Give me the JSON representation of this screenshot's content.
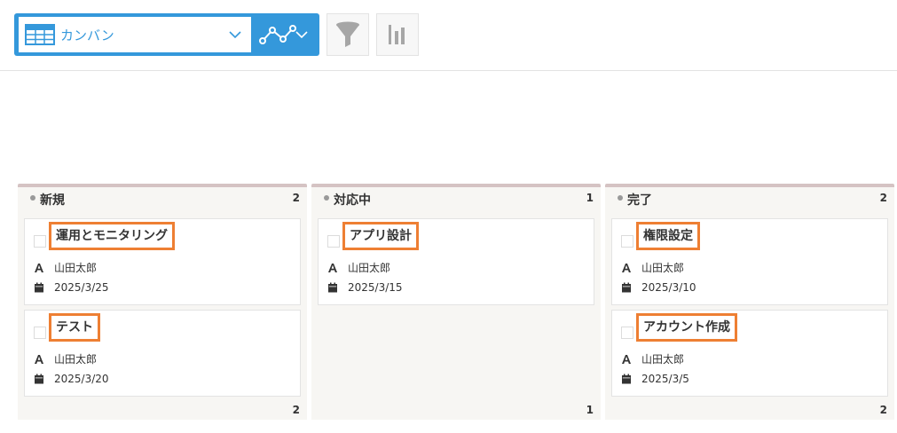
{
  "toolbar": {
    "view_name": "カンバン"
  },
  "columns": [
    {
      "title": "新規",
      "count": "2",
      "footer_count": "2",
      "cards": [
        {
          "title": "運用とモニタリング",
          "assignee": "山田太郎",
          "date": "2025/3/25"
        },
        {
          "title": "テスト",
          "assignee": "山田太郎",
          "date": "2025/3/20"
        }
      ]
    },
    {
      "title": "対応中",
      "count": "1",
      "footer_count": "1",
      "cards": [
        {
          "title": "アプリ設計",
          "assignee": "山田太郎",
          "date": "2025/3/15"
        }
      ]
    },
    {
      "title": "完了",
      "count": "2",
      "footer_count": "2",
      "cards": [
        {
          "title": "権限設定",
          "assignee": "山田太郎",
          "date": "2025/3/10"
        },
        {
          "title": "アカウント作成",
          "assignee": "山田太郎",
          "date": "2025/3/5"
        }
      ]
    }
  ],
  "colors": {
    "accent": "#3498db",
    "highlight": "#ee7f33",
    "column_bg": "#f7f6f3",
    "column_top": "#d5c3c3"
  }
}
